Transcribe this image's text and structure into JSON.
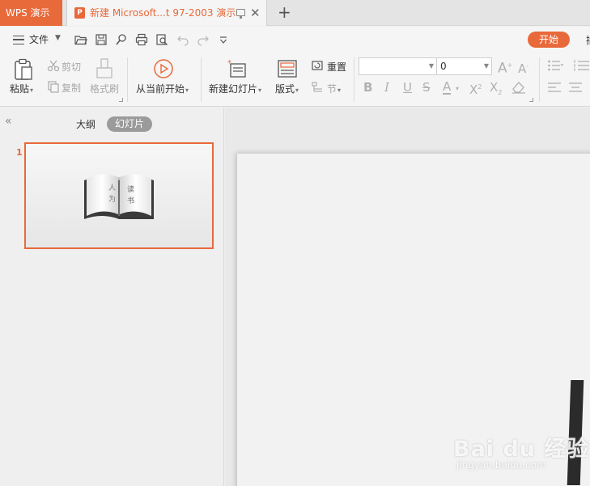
{
  "tabbar": {
    "app_tab": "WPS 演示",
    "doc_tab_logo": "P",
    "doc_tab_title": "新建 Microsoft...t 97-2003 演示",
    "close_glyph": "✕",
    "new_tab_glyph": "+"
  },
  "menu": {
    "file_label": "文件",
    "start_label": "开始",
    "cut_off_char": "插"
  },
  "ribbon": {
    "paste": "粘贴",
    "cut": "剪切",
    "copy": "复制",
    "format_painter": "格式刷",
    "play_from_current": "从当前开始",
    "new_slide": "新建幻灯片",
    "layout": "版式",
    "reset": "重置",
    "section": "节",
    "font_size_value": "0"
  },
  "panel": {
    "outline_tab": "大纲",
    "slides_tab": "幻灯片",
    "slide_number": "1",
    "book_chars": [
      "读",
      "书",
      "人",
      "为"
    ]
  },
  "watermark": {
    "main": "Bai du 经验",
    "sub": "jingyan.baidu.com"
  },
  "colors": {
    "accent": "#e8693a"
  }
}
